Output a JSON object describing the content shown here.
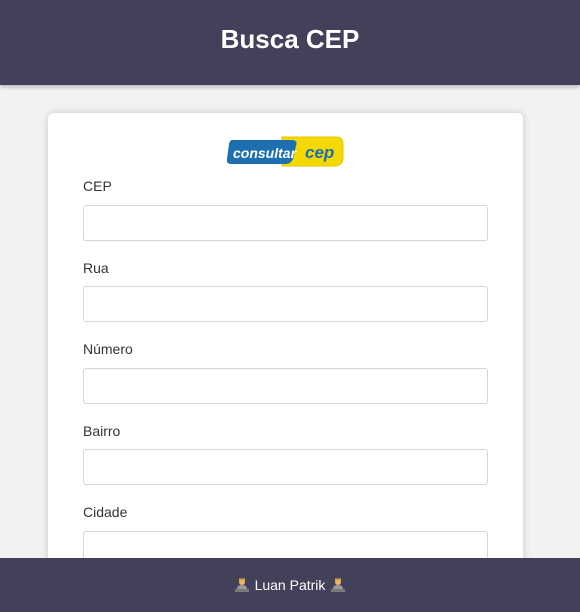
{
  "header": {
    "title": "Busca CEP"
  },
  "logo": {
    "text_left": "consultar",
    "text_right": "cep",
    "blue": "#1d6fb0",
    "yellow": "#f5d800"
  },
  "form": {
    "fields": [
      {
        "label": "CEP",
        "value": ""
      },
      {
        "label": "Rua",
        "value": ""
      },
      {
        "label": "Número",
        "value": ""
      },
      {
        "label": "Bairro",
        "value": ""
      },
      {
        "label": "Cidade",
        "value": ""
      }
    ]
  },
  "footer": {
    "author": "Luan Patrik",
    "icon": "user-icon"
  },
  "colors": {
    "header_bg": "#43405a",
    "page_bg": "#f2f2f2",
    "card_bg": "#ffffff"
  }
}
